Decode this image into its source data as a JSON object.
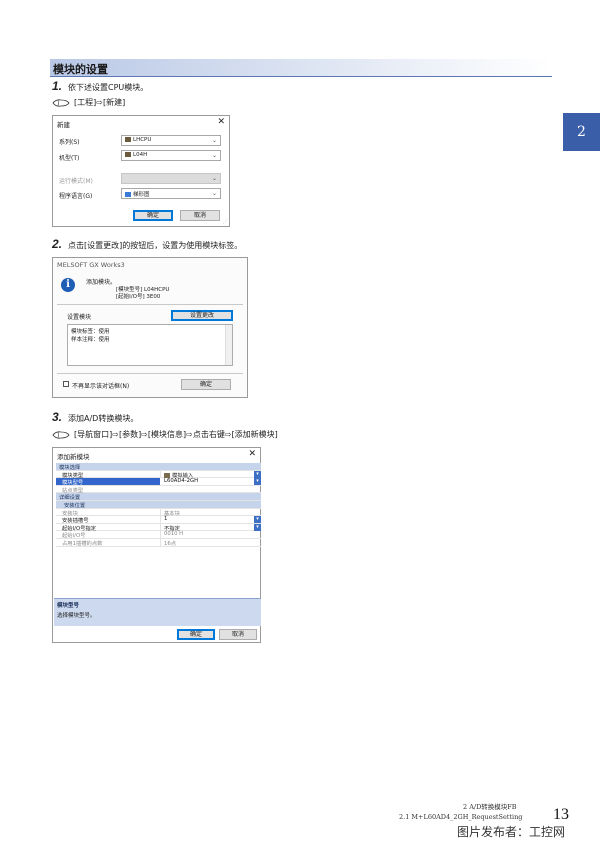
{
  "section_title": "模块的设置",
  "chapter_tab": "2",
  "steps": [
    {
      "num": "1.",
      "text": "依下述设置CPU模块。"
    },
    {
      "num": "2.",
      "text": "点击[设置更改]的按钮后，设置为使用模块标签。"
    },
    {
      "num": "3.",
      "text": "添加A/D转换模块。"
    }
  ],
  "ops": [
    {
      "icon": "mouse-icon",
      "text": "[工程]⇨[新建]"
    },
    {
      "icon": "mouse-icon",
      "text": "[导航窗口]⇨[参数]⇨[模块信息]⇨点击右键⇨[添加新模块]"
    }
  ],
  "dialog_new": {
    "title": "新建",
    "close": "✕",
    "series_label": "系列(S)",
    "series_value": "LHCPU",
    "model_label": "机型(T)",
    "model_value": "L04H",
    "mode_label": "运行模式(M)",
    "mode_value": "",
    "lang_label": "程序语言(G)",
    "lang_value": "梯形图",
    "ok": "确定",
    "cancel": "取消"
  },
  "dialog_melsoft": {
    "title": "MELSOFT GX Works3",
    "info_icon": "info-icon",
    "message": "添加模块。",
    "model_line": "[模块型号]  L04HCPU",
    "io_line": "[起始I/O号]  3E00",
    "setting_label": "设置模块",
    "change_button": "设置更改",
    "area_line1": "模块标签：使用",
    "area_line2": "样本注释：使用",
    "checkbox_label": "不再显示该对话框(N)",
    "ok": "确定"
  },
  "dialog_add": {
    "title": "添加新模块",
    "close": "✕",
    "rows": [
      {
        "key": "模块选择",
        "value": "",
        "kind": "hdr"
      },
      {
        "key": "模块类型",
        "value": "模拟输入",
        "kind": "normal",
        "dropdown": true,
        "icon": true
      },
      {
        "key": "模块型号",
        "value": "L60AD4-2GH",
        "kind": "sel",
        "dropdown": true
      },
      {
        "key": "站点类型",
        "value": "",
        "kind": "gray"
      },
      {
        "key": "详细设置",
        "value": "",
        "kind": "hdr"
      },
      {
        "key": "安装位置",
        "value": "",
        "kind": "hdr sub"
      },
      {
        "key": "安装块",
        "value": "基本块",
        "kind": "gray"
      },
      {
        "key": "安装插槽号",
        "value": "1",
        "kind": "normal",
        "dropdown": true
      },
      {
        "key": "起始I/O号指定",
        "value": "不指定",
        "kind": "normal",
        "dropdown": true
      },
      {
        "key": "起始I/O号",
        "value": "0010 H",
        "kind": "gray"
      },
      {
        "key": "占用1插槽的点数",
        "value": "16点",
        "kind": "gray"
      }
    ],
    "desc_title": "模块型号",
    "desc_text": "选择模块型号。",
    "ok": "确定",
    "cancel": "取消"
  },
  "footer": {
    "chapter_line": "2  A/D转换模块FB",
    "section_line": "2.1  M+L60AD4_2GH_RequestSetting",
    "page": "13",
    "watermark": "图片发布者：工控网"
  }
}
